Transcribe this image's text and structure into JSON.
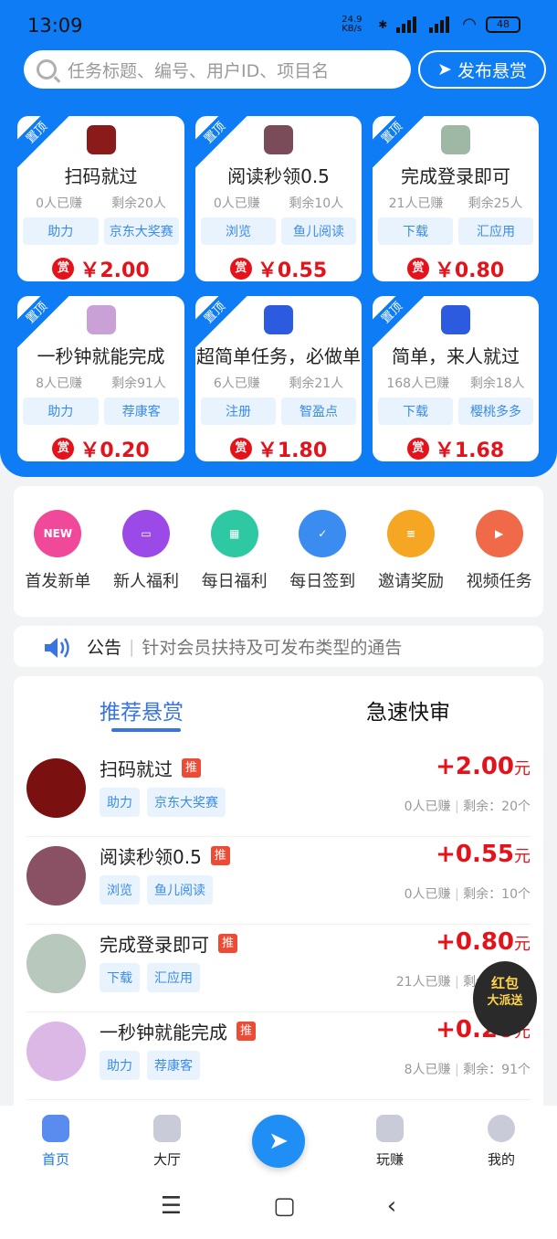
{
  "status_bar": {
    "time": "13:09",
    "net_speed": "24.9 KB/s",
    "battery": "48"
  },
  "search": {
    "placeholder": "任务标题、编号、用户ID、项目名"
  },
  "publish_button": "发布悬赏",
  "top_label": "置顶",
  "reward_label": "赏",
  "featured": [
    {
      "title": "扫码就过",
      "earned": "0人已赚",
      "remain": "剩余20人",
      "tag1": "助力",
      "tag2": "京东大奖赛",
      "price": "￥2.00",
      "icon_color": "#8b1a1a"
    },
    {
      "title": "阅读秒领0.5",
      "earned": "0人已赚",
      "remain": "剩余10人",
      "tag1": "浏览",
      "tag2": "鱼儿阅读",
      "price": "￥0.55",
      "icon_color": "#7a4c5a"
    },
    {
      "title": "完成登录即可",
      "earned": "21人已赚",
      "remain": "剩余25人",
      "tag1": "下载",
      "tag2": "汇应用",
      "price": "￥0.80",
      "icon_color": "#9fb8a6"
    },
    {
      "title": "一秒钟就能完成",
      "earned": "8人已赚",
      "remain": "剩余91人",
      "tag1": "助力",
      "tag2": "荐康客",
      "price": "￥0.20",
      "icon_color": "#c9a1d6"
    },
    {
      "title": "超简单任务，必做单",
      "earned": "6人已赚",
      "remain": "剩余21人",
      "tag1": "注册",
      "tag2": "智盈点",
      "price": "￥1.80",
      "icon_color": "#2d5be0"
    },
    {
      "title": "简单，来人就过",
      "earned": "168人已赚",
      "remain": "剩余18人",
      "tag1": "下载",
      "tag2": "樱桃多多",
      "price": "￥1.68",
      "icon_color": "#2d5be0"
    }
  ],
  "menu": [
    {
      "label": "首发新单",
      "color": "#f0499a",
      "icon": "NEW"
    },
    {
      "label": "新人福利",
      "color": "#9b4ae8",
      "icon": "▭"
    },
    {
      "label": "每日福利",
      "color": "#2ec9a3",
      "icon": "▦"
    },
    {
      "label": "每日签到",
      "color": "#3b8cf0",
      "icon": "✓"
    },
    {
      "label": "邀请奖励",
      "color": "#f5a623",
      "icon": "≡"
    },
    {
      "label": "视频任务",
      "color": "#f06a4a",
      "icon": "▶"
    }
  ],
  "notice": {
    "label": "公告",
    "text": "针对会员扶持及可发布类型的通告"
  },
  "tabs": {
    "recommended": "推荐悬赏",
    "fast": "急速快审"
  },
  "list": [
    {
      "title": "扫码就过",
      "badge": "推",
      "tag1": "助力",
      "tag2": "京东大奖赛",
      "price": "+2.00",
      "unit": "元",
      "earned": "0人已赚",
      "remain": "剩余：20个",
      "avatar_color": "#7a1010"
    },
    {
      "title": "阅读秒领0.5",
      "badge": "推",
      "tag1": "浏览",
      "tag2": "鱼儿阅读",
      "price": "+0.55",
      "unit": "元",
      "earned": "0人已赚",
      "remain": "剩余：10个",
      "avatar_color": "#8a5064"
    },
    {
      "title": "完成登录即可",
      "badge": "推",
      "tag1": "下载",
      "tag2": "汇应用",
      "price": "+0.80",
      "unit": "元",
      "earned": "21人已赚",
      "remain": "剩余：25个",
      "avatar_color": "#b8c8bc"
    },
    {
      "title": "一秒钟就能完成",
      "badge": "推",
      "tag1": "助力",
      "tag2": "荐康客",
      "price": "+0.20",
      "unit": "元",
      "earned": "8人已赚",
      "remain": "剩余：91个",
      "avatar_color": "#dcb8e6"
    }
  ],
  "hongbao": {
    "line1": "红包",
    "line2": "大派送"
  },
  "nav": [
    {
      "label": "首页"
    },
    {
      "label": "大厅"
    },
    {
      "label": ""
    },
    {
      "label": "玩赚"
    },
    {
      "label": "我的"
    }
  ],
  "sys_nav": {
    "menu": "☰",
    "home": "▢",
    "back": "‹"
  }
}
